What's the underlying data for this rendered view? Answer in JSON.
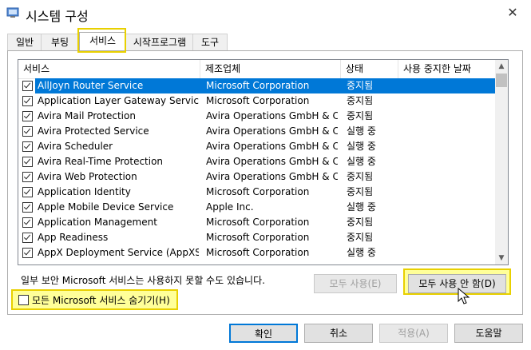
{
  "window": {
    "title": "시스템 구성",
    "close_symbol": "✕"
  },
  "tabs": [
    {
      "label": "일반"
    },
    {
      "label": "부팅"
    },
    {
      "label": "서비스",
      "active": true
    },
    {
      "label": "시작프로그램"
    },
    {
      "label": "도구"
    }
  ],
  "columns": {
    "service": "서비스",
    "manufacturer": "제조업체",
    "status": "상태",
    "disabled_date": "사용 중지한 날짜"
  },
  "services": [
    {
      "name": "AllJoyn Router Service",
      "manufacturer": "Microsoft Corporation",
      "status": "중지됨",
      "checked": true,
      "selected": true
    },
    {
      "name": "Application Layer Gateway Service",
      "manufacturer": "Microsoft Corporation",
      "status": "중지됨",
      "checked": true
    },
    {
      "name": "Avira Mail Protection",
      "manufacturer": "Avira Operations GmbH & C...",
      "status": "중지됨",
      "checked": true
    },
    {
      "name": "Avira Protected Service",
      "manufacturer": "Avira Operations GmbH & C...",
      "status": "실행 중",
      "checked": true
    },
    {
      "name": "Avira Scheduler",
      "manufacturer": "Avira Operations GmbH & C...",
      "status": "실행 중",
      "checked": true
    },
    {
      "name": "Avira Real-Time Protection",
      "manufacturer": "Avira Operations GmbH & C...",
      "status": "실행 중",
      "checked": true
    },
    {
      "name": "Avira Web Protection",
      "manufacturer": "Avira Operations GmbH & C...",
      "status": "중지됨",
      "checked": true
    },
    {
      "name": "Application Identity",
      "manufacturer": "Microsoft Corporation",
      "status": "중지됨",
      "checked": true
    },
    {
      "name": "Apple Mobile Device Service",
      "manufacturer": "Apple Inc.",
      "status": "실행 중",
      "checked": true
    },
    {
      "name": "Application Management",
      "manufacturer": "Microsoft Corporation",
      "status": "중지됨",
      "checked": true
    },
    {
      "name": "App Readiness",
      "manufacturer": "Microsoft Corporation",
      "status": "중지됨",
      "checked": true
    },
    {
      "name": "AppX Deployment Service (AppXSV...",
      "manufacturer": "Microsoft Corporation",
      "status": "실행 중",
      "checked": true
    }
  ],
  "note": "일부 보안 Microsoft 서비스는 사용하지 못할 수도 있습니다.",
  "buttons": {
    "enable_all": "모두 사용(E)",
    "disable_all": "모두 사용 안 함(D)",
    "hide_ms": "모든 Microsoft 서비스 숨기기(H)",
    "ok": "확인",
    "cancel": "취소",
    "apply": "적용(A)",
    "help": "도움말"
  },
  "colors": {
    "selection": "#0078d7",
    "highlight": "#ffff99",
    "highlight_border": "#e8d000"
  }
}
